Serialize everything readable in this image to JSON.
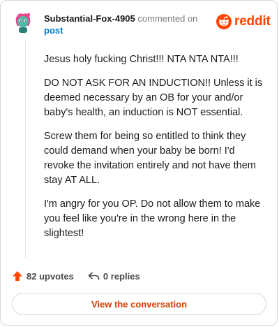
{
  "header": {
    "username": "Substantial-Fox-4905",
    "commented_text": "commented on",
    "post_link": "post"
  },
  "brand": {
    "wordmark": "reddit",
    "color": "#ff4500"
  },
  "comment": {
    "paragraphs": [
      "Jesus holy fucking Christ!!! NTA NTA NTA!!!",
      "DO NOT ASK FOR AN INDUCTION!! Unless it is deemed necessary by an OB for your and/or baby's health, an induction is NOT essential.",
      "Screw them for being so entitled to think they could demand when your baby be born! I'd revoke the invitation entirely and not have them stay AT ALL.",
      "I'm angry for you OP. Do not allow them to make you feel like you're in the wrong here in the slightest!"
    ]
  },
  "actions": {
    "upvotes": "82 upvotes",
    "replies": "0 replies"
  },
  "cta": {
    "label": "View the conversation"
  },
  "icons": {
    "avatar": "avatar-icon",
    "logo": "reddit-logo-icon",
    "upvote": "upvote-arrow-icon",
    "reply": "reply-arrow-icon"
  },
  "colors": {
    "accent": "#ff4500",
    "link": "#0079d3",
    "cta_text": "#d93a00"
  }
}
